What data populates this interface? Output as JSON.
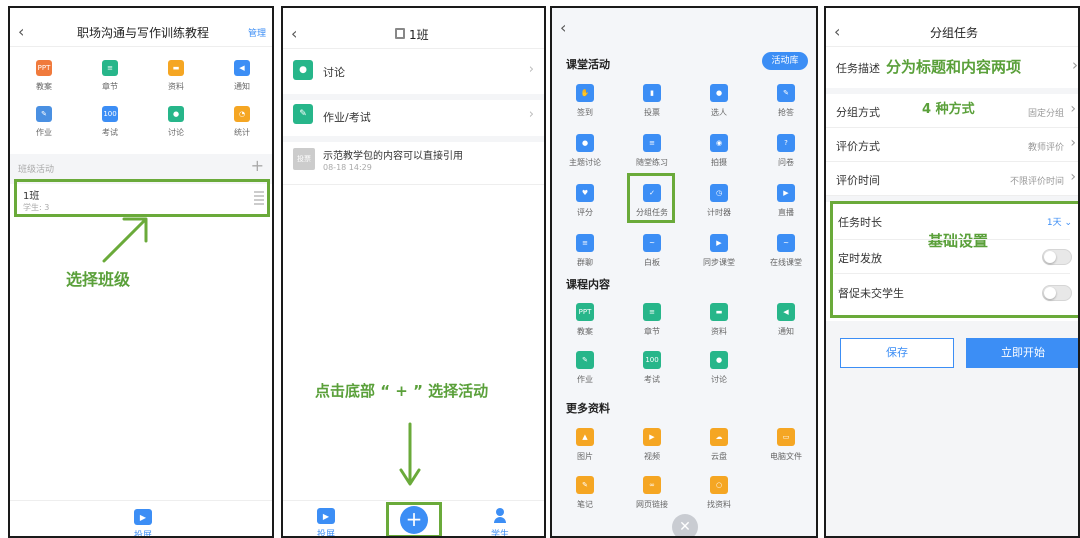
{
  "panel1": {
    "title": "职场沟通与写作训练教程",
    "manage": "管理",
    "grid": [
      {
        "label": "教案",
        "icon": "ppt-icon",
        "color": "#f07a3c",
        "glyph": "PPT"
      },
      {
        "label": "章节",
        "icon": "chapter-icon",
        "color": "#27b68a",
        "glyph": "≡"
      },
      {
        "label": "资料",
        "icon": "folder-icon",
        "color": "#f5a623",
        "glyph": "▬"
      },
      {
        "label": "通知",
        "icon": "megaphone-icon",
        "color": "#3c8ef5",
        "glyph": "◀"
      },
      {
        "label": "作业",
        "icon": "homework-icon",
        "color": "#4a90e2",
        "glyph": "✎"
      },
      {
        "label": "考试",
        "icon": "exam-icon",
        "color": "#3c8ef5",
        "glyph": "100"
      },
      {
        "label": "讨论",
        "icon": "discuss-icon",
        "color": "#27b68a",
        "glyph": "●"
      },
      {
        "label": "统计",
        "icon": "pie-chart-icon",
        "color": "#f5a623",
        "glyph": "◔"
      }
    ],
    "section_label": "班级活动",
    "class_name": "1班",
    "class_students": "学生: 3",
    "annotation": "选择班级",
    "bottom_label": "投屏"
  },
  "panel2": {
    "title": "1班",
    "items": [
      {
        "label": "讨论",
        "icon": "discuss-icon",
        "color": "#27b68a"
      },
      {
        "label": "作业/考试",
        "icon": "homework-icon",
        "color": "#27b68a"
      }
    ],
    "vote_badge": "投票",
    "vote_title": "示范教学包的内容可以直接引用",
    "vote_time": "08-18 14:29",
    "annotation": "点击底部 “ + ” 选择活动",
    "bottom_left": "投屏",
    "bottom_right": "学生"
  },
  "panel3": {
    "sec1_title": "课堂活动",
    "library_btn": "活动库",
    "activities": [
      {
        "label": "签到",
        "icon": "checkin-icon",
        "color": "#3c8ef5",
        "glyph": "✋"
      },
      {
        "label": "投票",
        "icon": "vote-icon",
        "color": "#3c8ef5",
        "glyph": "▮"
      },
      {
        "label": "选人",
        "icon": "pick-person-icon",
        "color": "#3c8ef5",
        "glyph": "●"
      },
      {
        "label": "抢答",
        "icon": "quick-answer-icon",
        "color": "#3c8ef5",
        "glyph": "✎"
      },
      {
        "label": "主题讨论",
        "icon": "topic-discuss-icon",
        "color": "#3c8ef5",
        "glyph": "●"
      },
      {
        "label": "随堂练习",
        "icon": "practice-icon",
        "color": "#3c8ef5",
        "glyph": "≡"
      },
      {
        "label": "拍摄",
        "icon": "camera-icon",
        "color": "#3c8ef5",
        "glyph": "◉"
      },
      {
        "label": "问卷",
        "icon": "questionnaire-icon",
        "color": "#3c8ef5",
        "glyph": "?"
      },
      {
        "label": "评分",
        "icon": "score-icon",
        "color": "#3c8ef5",
        "glyph": "♥"
      },
      {
        "label": "分组任务",
        "icon": "group-task-icon",
        "color": "#3c8ef5",
        "glyph": "✓"
      },
      {
        "label": "计时器",
        "icon": "timer-icon",
        "color": "#3c8ef5",
        "glyph": "◷"
      },
      {
        "label": "直播",
        "icon": "live-icon",
        "color": "#3c8ef5",
        "glyph": "▶"
      },
      {
        "label": "群聊",
        "icon": "group-chat-icon",
        "color": "#3c8ef5",
        "glyph": "≡"
      },
      {
        "label": "白板",
        "icon": "whiteboard-icon",
        "color": "#3c8ef5",
        "glyph": "~"
      },
      {
        "label": "同步课堂",
        "icon": "sync-class-icon",
        "color": "#3c8ef5",
        "glyph": "▶"
      },
      {
        "label": "在线课堂",
        "icon": "online-class-icon",
        "color": "#3c8ef5",
        "glyph": "~"
      }
    ],
    "sec2_title": "课程内容",
    "content": [
      {
        "label": "教案",
        "icon": "ppt-icon",
        "color": "#27b68a",
        "glyph": "PPT"
      },
      {
        "label": "章节",
        "icon": "chapter-icon",
        "color": "#27b68a",
        "glyph": "≡"
      },
      {
        "label": "资料",
        "icon": "folder-icon",
        "color": "#27b68a",
        "glyph": "▬"
      },
      {
        "label": "通知",
        "icon": "megaphone-icon",
        "color": "#27b68a",
        "glyph": "◀"
      },
      {
        "label": "作业",
        "icon": "homework-icon",
        "color": "#27b68a",
        "glyph": "✎"
      },
      {
        "label": "考试",
        "icon": "exam-icon",
        "color": "#27b68a",
        "glyph": "100"
      },
      {
        "label": "讨论",
        "icon": "discuss-icon",
        "color": "#27b68a",
        "glyph": "●"
      }
    ],
    "sec3_title": "更多资料",
    "more": [
      {
        "label": "图片",
        "icon": "image-icon",
        "color": "#f5a623",
        "glyph": "▲"
      },
      {
        "label": "视频",
        "icon": "video-icon",
        "color": "#f5a623",
        "glyph": "▶"
      },
      {
        "label": "云盘",
        "icon": "cloud-icon",
        "color": "#f5a623",
        "glyph": "☁"
      },
      {
        "label": "电脑文件",
        "icon": "computer-icon",
        "color": "#f5a623",
        "glyph": "▭"
      },
      {
        "label": "笔记",
        "icon": "note-icon",
        "color": "#f5a623",
        "glyph": "✎"
      },
      {
        "label": "网页链接",
        "icon": "link-icon",
        "color": "#f5a623",
        "glyph": "∞"
      },
      {
        "label": "找资料",
        "icon": "find-icon",
        "color": "#f5a623",
        "glyph": "○"
      }
    ]
  },
  "panel4": {
    "title": "分组任务",
    "desc_label": "任务描述",
    "desc_annotation": "分为标题和内容两项",
    "rows": [
      {
        "label": "分组方式",
        "value": "固定分组"
      },
      {
        "label": "评价方式",
        "value": "教师评价"
      },
      {
        "label": "评价时间",
        "value": "不限评价时间"
      }
    ],
    "method_annotation": "4 种方式",
    "duration_label": "任务时长",
    "duration_value": "1天",
    "schedule_label": "定时发放",
    "remind_label": "督促未交学生",
    "basic_annotation": "基础设置",
    "save_btn": "保存",
    "start_btn": "立即开始"
  }
}
